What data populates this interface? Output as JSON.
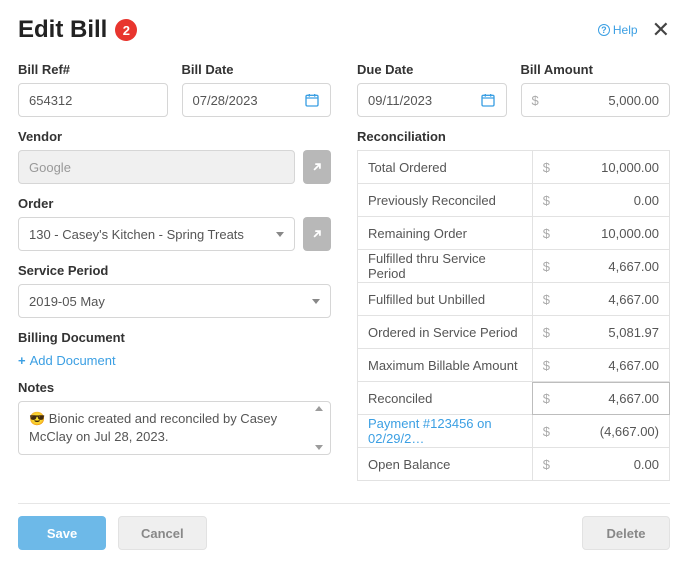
{
  "header": {
    "title": "Edit Bill",
    "badge": "2",
    "help_label": "Help"
  },
  "left": {
    "bill_ref_label": "Bill Ref#",
    "bill_ref_value": "654312",
    "bill_date_label": "Bill Date",
    "bill_date_value": "07/28/2023",
    "vendor_label": "Vendor",
    "vendor_value": "Google",
    "order_label": "Order",
    "order_value": "130 - Casey's Kitchen - Spring Treats",
    "service_period_label": "Service Period",
    "service_period_value": "2019-05 May",
    "billing_doc_label": "Billing Document",
    "add_doc_label": "Add Document",
    "notes_label": "Notes",
    "notes_value": "😎 Bionic created and reconciled by Casey McClay on Jul 28, 2023."
  },
  "right": {
    "due_date_label": "Due Date",
    "due_date_value": "09/11/2023",
    "bill_amount_label": "Bill Amount",
    "bill_amount_value": "5,000.00",
    "recon_label": "Reconciliation",
    "rows": [
      {
        "label": "Total Ordered",
        "value": "10,000.00"
      },
      {
        "label": "Previously Reconciled",
        "value": "0.00"
      },
      {
        "label": "Remaining Order",
        "value": "10,000.00"
      },
      {
        "label": "Fulfilled thru Service Period",
        "value": "4,667.00"
      },
      {
        "label": "Fulfilled but Unbilled",
        "value": "4,667.00"
      },
      {
        "label": "Ordered in Service Period",
        "value": "5,081.97"
      },
      {
        "label": "Maximum Billable Amount",
        "value": "4,667.00"
      },
      {
        "label": "Reconciled",
        "value": "4,667.00"
      },
      {
        "label": "Payment #123456 on 02/29/2…",
        "value": "(4,667.00)"
      },
      {
        "label": "Open Balance",
        "value": "0.00"
      }
    ]
  },
  "footer": {
    "save": "Save",
    "cancel": "Cancel",
    "delete": "Delete"
  },
  "currency": "$"
}
